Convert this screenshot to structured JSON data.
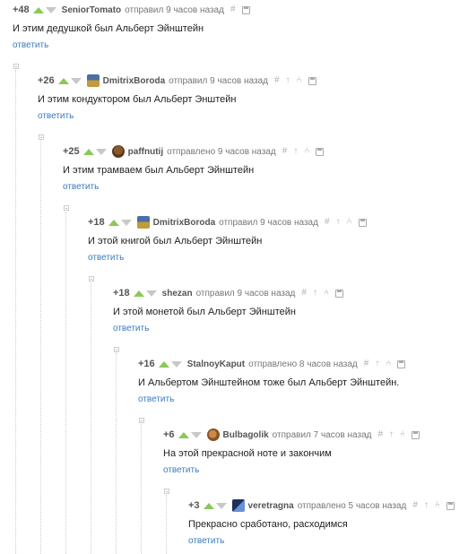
{
  "reply_label": "ответить",
  "comments": [
    {
      "score": "+48",
      "author": "SeniorTomato",
      "posted": "отправил 9 часов назад",
      "text": "И этим дедушкой был Альберт Эйнштейн",
      "avatar": "none"
    },
    {
      "score": "+26",
      "author": "DmitrixBoroda",
      "posted": "отправил 9 часов назад",
      "text": "И этим кондуктором был Альберт Энштейн",
      "avatar": "landscape-avatar"
    },
    {
      "score": "+25",
      "author": "paffnutij",
      "posted": "отправлено 9 часов назад",
      "text": "И этим трамваем был Альберт Эйнштейн",
      "avatar": "brown-creature-avatar"
    },
    {
      "score": "+18",
      "author": "DmitrixBoroda",
      "posted": "отправил 9 часов назад",
      "text": "И этой книгой был Альберт Эйнштейн",
      "avatar": "landscape-avatar"
    },
    {
      "score": "+18",
      "author": "shezan",
      "posted": "отправил 9 часов назад",
      "text": "И этой монетой был Альберт Эйнштейн",
      "avatar": "none"
    },
    {
      "score": "+16",
      "author": "StalnoyKaput",
      "posted": "отправлено 8 часов назад",
      "text": "И Альбертом Эйнштейном тоже был Альберт Эйнштейн.",
      "avatar": "none"
    },
    {
      "score": "+6",
      "author": "Bulbagolik",
      "posted": "отправил 7 часов назад",
      "text": "На этой прекрасной ноте и закончим",
      "avatar": "potato-avatar"
    },
    {
      "score": "+3",
      "author": "veretragna",
      "posted": "отправлено 5 часов назад",
      "text": "Прекрасно сработано, расходимся",
      "avatar": "blue-figure-avatar"
    }
  ],
  "icons": {
    "hash": "hash-icon",
    "go_up": "arrow-up-icon",
    "branch": "branch-icon",
    "save": "save-icon",
    "vote_up": "vote-up-icon",
    "vote_down": "vote-down-icon"
  },
  "colors": {
    "vote_up": "#8ac858",
    "vote_down": "#c8c8c8",
    "reply_link": "#3a7bbf",
    "thread_line": "#cfcfcf"
  }
}
